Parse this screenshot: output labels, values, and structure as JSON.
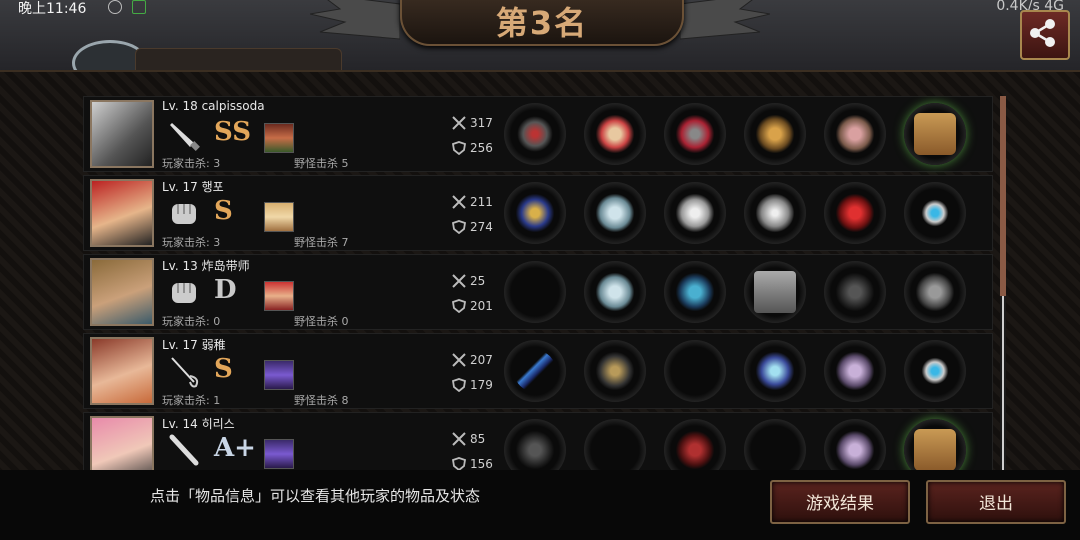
{
  "status_bar": {
    "time": "晚上11:46",
    "right": "0.4K/s  4G"
  },
  "title": "第3名",
  "hint": "点击「物品信息」可以查看其他玩家的物品及状态",
  "buttons": {
    "result": "游戏结果",
    "exit": "退出"
  },
  "players": [
    {
      "level": "Lv. 18 calpissoda",
      "grade": "SS",
      "weapon_icon": "knife-icon",
      "player_kills": "玩家击杀: 3",
      "monster_kills": "野怪击杀 5",
      "attack": "317",
      "defense": "256",
      "items": [
        "weapon",
        "headgear",
        "armor",
        "arm-guard",
        "leg-guard",
        "box"
      ]
    },
    {
      "level": "Lv. 17 행포",
      "grade": "S",
      "weapon_icon": "glove-icon",
      "player_kills": "玩家击杀: 3",
      "monster_kills": "野怪击杀 7",
      "attack": "211",
      "defense": "274",
      "items": [
        "gauntlet",
        "helmet",
        "armor",
        "disc",
        "shoes",
        "bracelet"
      ]
    },
    {
      "level": "Lv. 13 炸岛带师",
      "grade": "D",
      "weapon_icon": "glove-icon",
      "player_kills": "玩家击杀: 0",
      "monster_kills": "野怪击杀 0",
      "attack": "25",
      "defense": "201",
      "items": [
        "empty",
        "helmet",
        "armor",
        "device",
        "boots",
        "armor"
      ]
    },
    {
      "level": "Lv. 17 弱稚",
      "grade": "S",
      "weapon_icon": "rapier-icon",
      "player_kills": "玩家击杀: 1",
      "monster_kills": "野怪击杀 8",
      "attack": "207",
      "defense": "179",
      "items": [
        "weapon",
        "helmet",
        "empty",
        "weapon",
        "boots",
        "bracelet"
      ]
    },
    {
      "level": "Lv. 14 히리스",
      "grade": "A+",
      "weapon_icon": "bat-icon",
      "player_kills": "",
      "monster_kills": "",
      "attack": "85",
      "defense": "156",
      "items": [
        "umbrella",
        "empty",
        "armor",
        "empty",
        "boots",
        "box"
      ]
    }
  ],
  "colors": {
    "accent": "#d7a977",
    "button": "#5a231e",
    "grade_gold": "#e2a65a"
  }
}
